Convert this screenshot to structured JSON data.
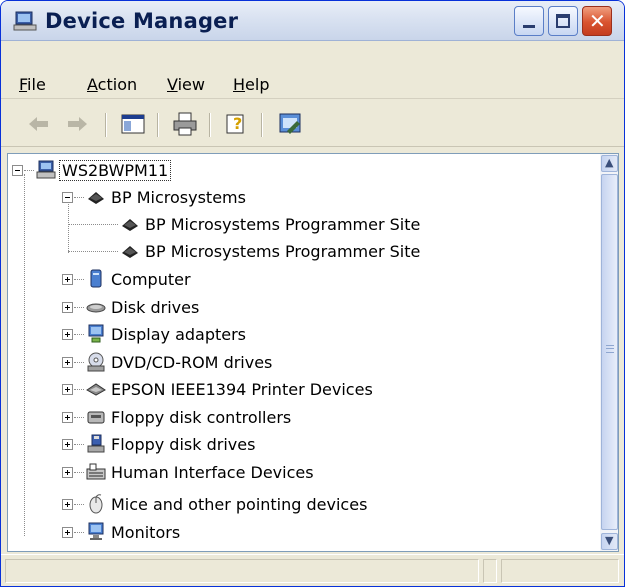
{
  "window": {
    "title": "Device Manager",
    "colors": {
      "title_text": "#0a1f52",
      "close_button": "#d9532f",
      "chrome": "#ece9d8"
    }
  },
  "titlebar_buttons": {
    "minimize": "minimize-icon",
    "maximize": "maximize-icon",
    "close": "close-icon",
    "close_glyph": "✕"
  },
  "menu": {
    "file": {
      "accel": "F",
      "rest": "ile"
    },
    "action": {
      "accel": "A",
      "rest": "ction"
    },
    "view": {
      "accel": "V",
      "rest": "iew"
    },
    "help": {
      "accel": "H",
      "rest": "elp"
    }
  },
  "toolbar": {
    "back": "back-arrow-icon",
    "forward": "forward-arrow-icon",
    "console": "show-hide-console-tree-icon",
    "print": "print-icon",
    "help": "help-icon",
    "properties": "properties-icon"
  },
  "tree": {
    "root": {
      "label": "WS2BWPM11",
      "icon": "computer-icon",
      "expanded": true
    },
    "nodes": [
      {
        "label": "BP Microsystems",
        "icon": "device-chip-icon",
        "expanded": true
      },
      {
        "label": "BP Microsystems Programmer Site",
        "icon": "device-chip-icon"
      },
      {
        "label": "BP Microsystems Programmer Site",
        "icon": "device-chip-icon"
      },
      {
        "label": "Computer",
        "icon": "computer-icon",
        "expanded": false
      },
      {
        "label": "Disk drives",
        "icon": "disk-drive-icon",
        "expanded": false
      },
      {
        "label": "Display adapters",
        "icon": "display-adapter-icon",
        "expanded": false
      },
      {
        "label": "DVD/CD-ROM drives",
        "icon": "cd-drive-icon",
        "expanded": false
      },
      {
        "label": "EPSON IEEE1394 Printer Devices",
        "icon": "printer-device-icon",
        "expanded": false
      },
      {
        "label": "Floppy disk controllers",
        "icon": "floppy-controller-icon",
        "expanded": false
      },
      {
        "label": "Floppy disk drives",
        "icon": "floppy-drive-icon",
        "expanded": false
      },
      {
        "label": "Human Interface Devices",
        "icon": "keyboard-icon",
        "expanded": false
      },
      {
        "label": "Mice and other pointing devices",
        "icon": "mouse-icon",
        "expanded": false
      },
      {
        "label": "Monitors",
        "icon": "monitor-icon",
        "expanded": false
      }
    ]
  },
  "scrollbar": {
    "up": "scroll-up-icon",
    "down": "scroll-down-icon",
    "up_glyph": "▲",
    "down_glyph": "▼"
  },
  "status": {
    "text": ""
  }
}
